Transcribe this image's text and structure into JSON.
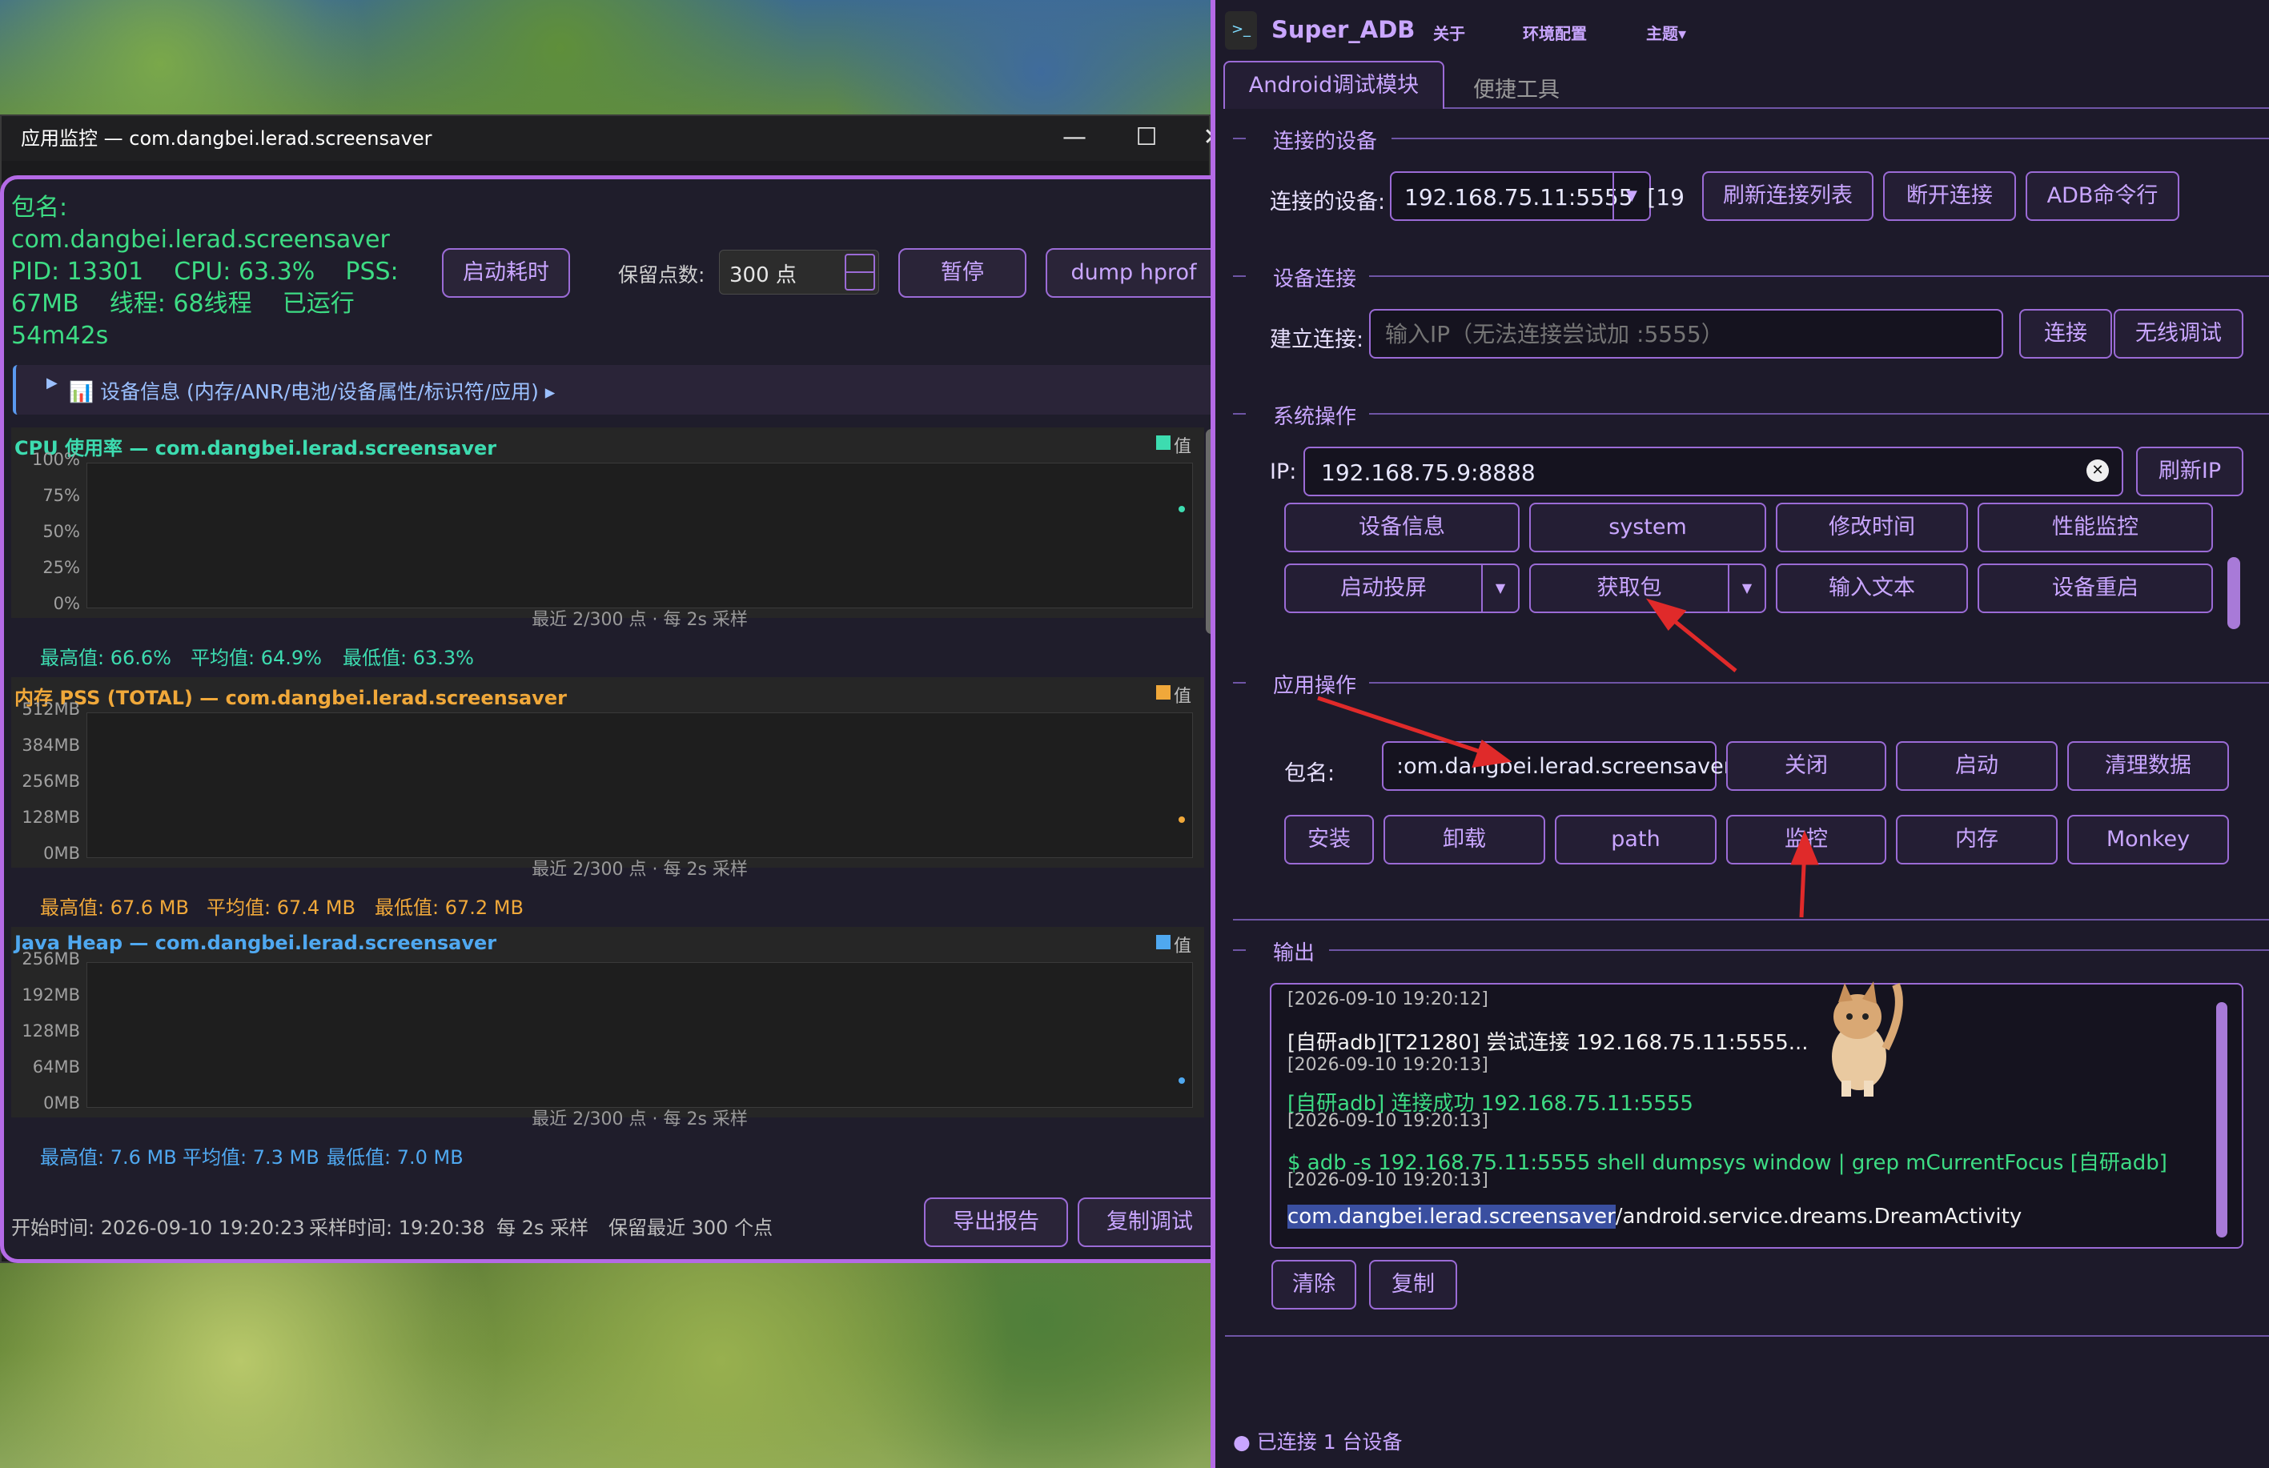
{
  "monitor": {
    "window_title": "应用监控 — com.dangbei.lerad.screensaver",
    "info": {
      "pkg_label": "包名:",
      "pkg": "com.dangbei.lerad.screensaver",
      "line3": "PID: 13301    CPU: 63.3%    PSS:",
      "line4": "67MB    线程: 68线程    已运行",
      "line5": "54m42s"
    },
    "btn_startup": "启动耗时",
    "keep_label": "保留点数:",
    "keep_value": "300 点",
    "btn_pause": "暂停",
    "btn_dump": "dump hprof",
    "device_info": "📊 设备信息 (内存/ANR/电池/设备属性/标识符/应用) ▸",
    "charts": [
      {
        "title": "CPU 使用率 — com.dangbei.lerad.screensaver",
        "color": "#3ddcb0",
        "legend": "值",
        "yticks": [
          "100%",
          "75%",
          "50%",
          "25%",
          "0%"
        ],
        "caption": "最近 2/300 点 · 每 2s 采样",
        "stats": [
          "最高值: 66.6%",
          "平均值: 64.9%",
          "最低值: 63.3%"
        ]
      },
      {
        "title": "内存 PSS (TOTAL) — com.dangbei.lerad.screensaver",
        "color": "#f0a83a",
        "legend": "值",
        "yticks": [
          "512MB",
          "384MB",
          "256MB",
          "128MB",
          "0MB"
        ],
        "caption": "最近 2/300 点 · 每 2s 采样",
        "stats": [
          "最高值: 67.6 MB",
          "平均值: 67.4 MB",
          "最低值: 67.2 MB"
        ]
      },
      {
        "title": "Java Heap — com.dangbei.lerad.screensaver",
        "color": "#4fa8f0",
        "legend": "值",
        "yticks": [
          "256MB",
          "192MB",
          "128MB",
          "64MB",
          "0MB"
        ],
        "caption": "最近 2/300 点 · 每 2s 采样",
        "stats": [
          "最高值: 7.6 MB",
          "平均值: 7.3 MB",
          "最低值: 7.0 MB"
        ]
      }
    ],
    "footer": {
      "start": "开始时间: 2026-09-10 19:20:23",
      "sample": "采样时间: 19:20:38",
      "interval": "每 2s 采样",
      "keep": "保留最近 300 个点",
      "btn_export": "导出报告",
      "btn_copy": "复制调试"
    }
  },
  "app": {
    "title": "Super_ADB",
    "menu": [
      "关于",
      "环境配置",
      "主题▾"
    ],
    "tabs": [
      "Android调试模块",
      "便捷工具"
    ],
    "sec_connected": "连接的设备",
    "connected_label": "连接的设备:",
    "connected_value": "192.168.75.11:5555  [19",
    "btn_refresh_list": "刷新连接列表",
    "btn_disconnect": "断开连接",
    "btn_adb_cmd": "ADB命令行",
    "sec_connect": "设备连接",
    "connect_label": "建立连接:",
    "connect_placeholder": "输入IP（无法连接尝试加 :5555）",
    "btn_connect": "连接",
    "btn_wireless": "无线调试",
    "sec_system": "系统操作",
    "ip_label": "IP:",
    "ip_value": "192.168.75.9:8888",
    "btn_refresh_ip": "刷新IP",
    "sys_buttons_row1": [
      "设备信息",
      "system",
      "修改时间",
      "性能监控"
    ],
    "sys_buttons_row2": [
      "启动投屏",
      "获取包",
      "输入文本",
      "设备重启"
    ],
    "sec_app": "应用操作",
    "pkg_label": "包名:",
    "pkg_value": ":om.dangbei.lerad.screensaver",
    "app_buttons_row1": [
      "关闭",
      "启动",
      "清理数据"
    ],
    "app_buttons_row2": [
      "安装",
      "卸载",
      "path",
      "监控",
      "内存",
      "Monkey"
    ],
    "sec_output": "输出",
    "output": [
      {
        "text": "[2026-09-10 19:20:12]",
        "c": "#bdbdbd",
        "s": "22px"
      },
      {
        "text": "[自研adb][T21280] 尝试连接 192.168.75.11:5555...",
        "c": "#f2f2f2",
        "s": "26px"
      },
      {
        "text": "[2026-09-10 19:20:13]",
        "c": "#bdbdbd",
        "s": "22px"
      },
      {
        "text": "[自研adb] 连接成功 192.168.75.11:5555",
        "c": "#3ddc84",
        "s": "26px"
      },
      {
        "text": "[2026-09-10 19:20:13]",
        "c": "#bdbdbd",
        "s": "22px"
      },
      {
        "text": "$ adb -s 192.168.75.11:5555 shell dumpsys window | grep mCurrentFocus [自研adb]",
        "c": "#3ddc84",
        "s": "26px"
      },
      {
        "text": "[2026-09-10 19:20:13]",
        "c": "#bdbdbd",
        "s": "22px"
      }
    ],
    "output_last_sel": "com.dangbei.lerad.screensaver",
    "output_last_rest": "/android.service.dreams.DreamActivity",
    "btn_clear": "清除",
    "btn_copy": "复制",
    "status": "● 已连接 1 台设备"
  }
}
